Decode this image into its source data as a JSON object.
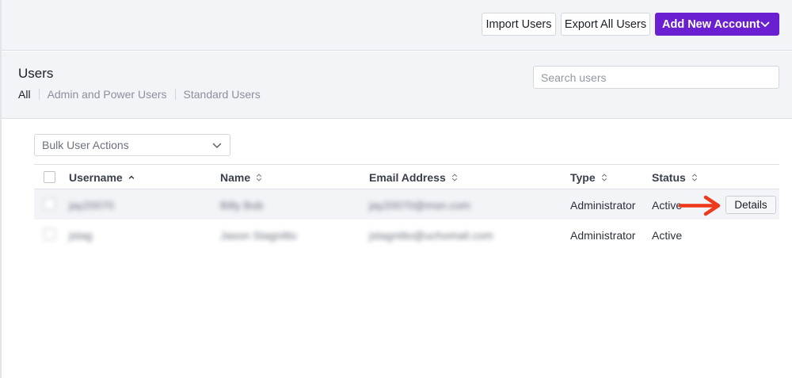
{
  "toolbar": {
    "import_label": "Import Users",
    "export_label": "Export All Users",
    "add_label": "Add New Account"
  },
  "header": {
    "title": "Users",
    "filters": [
      {
        "label": "All",
        "active": true
      },
      {
        "label": "Admin and Power Users",
        "active": false
      },
      {
        "label": "Standard Users",
        "active": false
      }
    ],
    "search_placeholder": "Search users"
  },
  "bulk_actions": {
    "label": "Bulk User Actions"
  },
  "table": {
    "columns": [
      {
        "label": "Username",
        "sort": "asc"
      },
      {
        "label": "Name",
        "sort": "none"
      },
      {
        "label": "Email Address",
        "sort": "none"
      },
      {
        "label": "Type",
        "sort": "none"
      },
      {
        "label": "Status",
        "sort": "none"
      }
    ],
    "rows": [
      {
        "username": "jay20070",
        "name": "Billy Bob",
        "email": "jay20070@msn.com",
        "type": "Administrator",
        "status": "Active",
        "action": "Details"
      },
      {
        "username": "jstag",
        "name": "Jason Stagnitto",
        "email": "jstagnitto@uchomail.com",
        "type": "Administrator",
        "status": "Active"
      }
    ]
  },
  "colors": {
    "accent": "#6a1fd0",
    "arrow": "#ee3a1c",
    "panel": "#f2f4f7"
  }
}
